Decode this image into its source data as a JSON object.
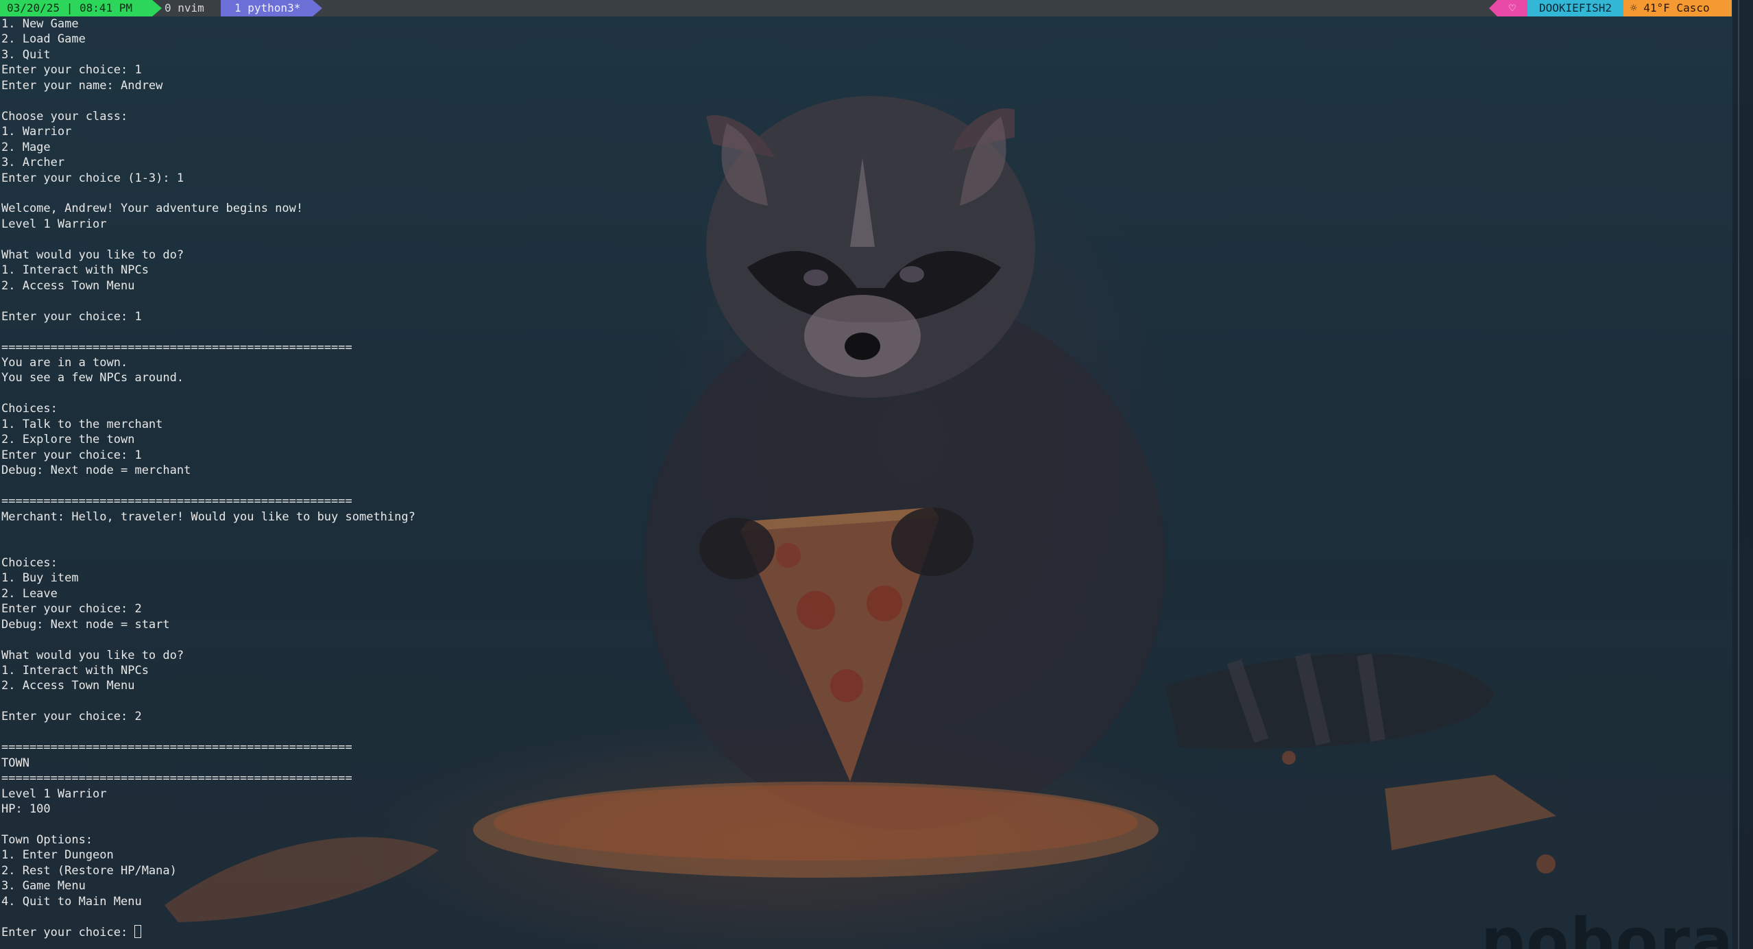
{
  "status_bar": {
    "datetime": "03/20/25 | 08:41 PM",
    "window_0": "0 nvim",
    "window_1": "1 python3*",
    "heart_icon": "heart-icon",
    "hostname": "DOOKIEFISH2",
    "weather": "☼ 41°F Casco"
  },
  "terminal": {
    "lines": [
      "1. New Game",
      "2. Load Game",
      "3. Quit",
      "Enter your choice: 1",
      "Enter your name: Andrew",
      "",
      "Choose your class:",
      "1. Warrior",
      "2. Mage",
      "3. Archer",
      "Enter your choice (1-3): 1",
      "",
      "Welcome, Andrew! Your adventure begins now!",
      "Level 1 Warrior",
      "",
      "What would you like to do?",
      "1. Interact with NPCs",
      "2. Access Town Menu",
      "",
      "Enter your choice: 1",
      "",
      "==================================================",
      "You are in a town.",
      "You see a few NPCs around.",
      "",
      "Choices:",
      "1. Talk to the merchant",
      "2. Explore the town",
      "Enter your choice: 1",
      "Debug: Next node = merchant",
      "",
      "==================================================",
      "Merchant: Hello, traveler! Would you like to buy something?",
      "",
      "",
      "Choices:",
      "1. Buy item",
      "2. Leave",
      "Enter your choice: 2",
      "Debug: Next node = start",
      "",
      "What would you like to do?",
      "1. Interact with NPCs",
      "2. Access Town Menu",
      "",
      "Enter your choice: 2",
      "",
      "==================================================",
      "TOWN",
      "==================================================",
      "Level 1 Warrior",
      "HP: 100",
      "",
      "Town Options:",
      "1. Enter Dungeon",
      "2. Rest (Restore HP/Mana)",
      "3. Game Menu",
      "4. Quit to Main Menu",
      ""
    ],
    "prompt": "Enter your choice: "
  },
  "watermark": "pobora",
  "colors": {
    "date_segment": "#2bd65a",
    "active_window": "#6b6fd6",
    "heart_segment": "#e94aa8",
    "host_segment": "#33b7d6",
    "weather_segment": "#f59a32",
    "terminal_text": "#e8e8e8"
  }
}
